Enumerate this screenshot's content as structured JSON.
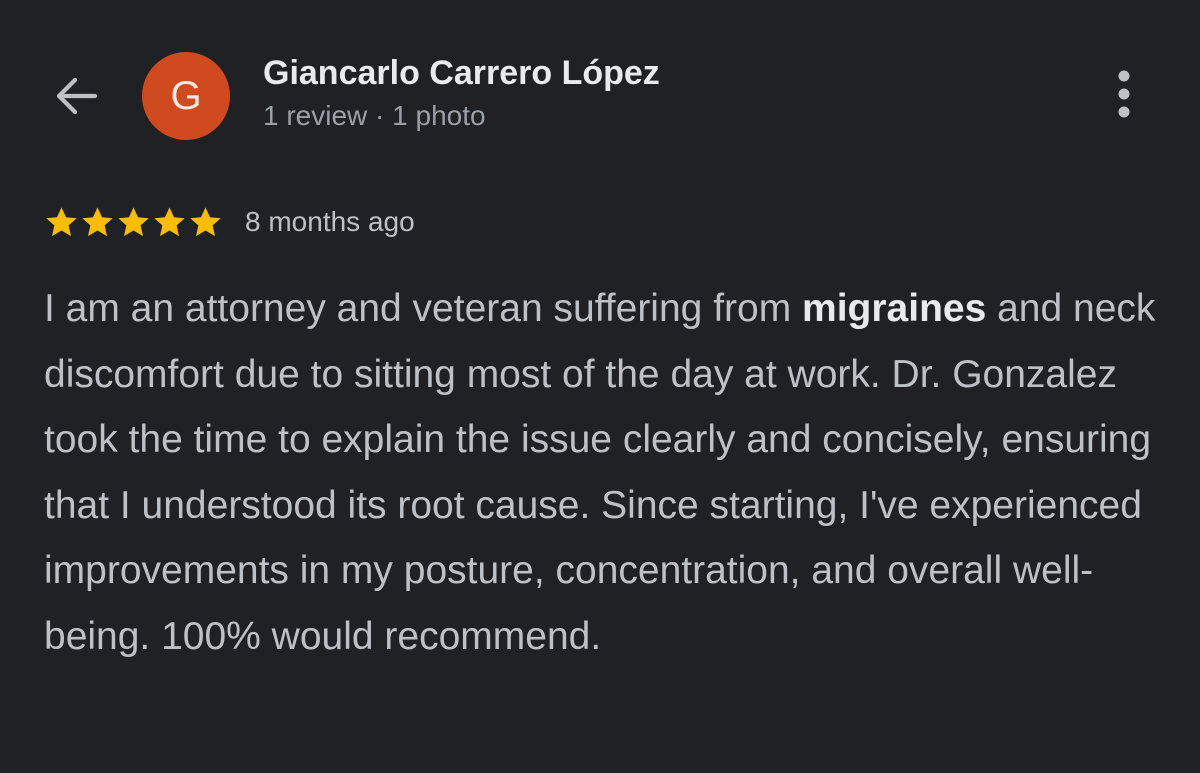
{
  "header": {
    "avatar_letter": "G",
    "avatar_color": "#d04a1f",
    "reviewer_name": "Giancarlo Carrero López",
    "reviewer_meta": "1 review · 1 photo",
    "back_icon": "arrow-left-icon",
    "more_icon": "more-vert-icon"
  },
  "review": {
    "rating": 5,
    "max_rating": 5,
    "star_color": "#fbbc04",
    "time_ago": "8 months ago",
    "text_part1": "I am an attorney and veteran suffering from ",
    "highlight": "migraines",
    "text_part2": " and neck discomfort due to sitting most of the day at work. Dr. Gonzalez took the time to explain the issue clearly and concisely, ensuring that I understood its root cause. Since starting, I've experienced improvements in my posture, concentration, and overall well-being. 100% would recommend."
  }
}
